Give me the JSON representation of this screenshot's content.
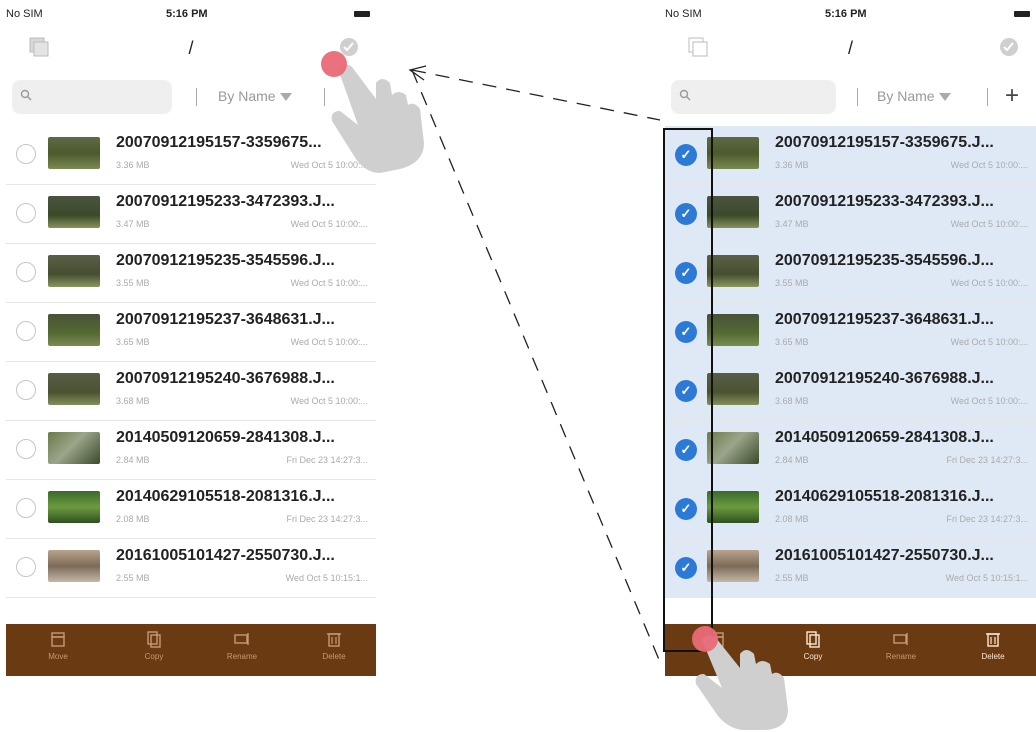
{
  "left_screen": {
    "status": {
      "carrier": "No SIM",
      "time": "5:16 PM"
    },
    "nav_title": "/",
    "search_placeholder": "",
    "sort_label": "By Name",
    "toolbar": [
      {
        "label": "Move",
        "icon": "move-icon"
      },
      {
        "label": "Copy",
        "icon": "copy-icon"
      },
      {
        "label": "Rename",
        "icon": "rename-icon"
      },
      {
        "label": "Delete",
        "icon": "trash-icon"
      }
    ],
    "files": [
      {
        "name": "20070912195157-3359675...",
        "size": "3.36 MB",
        "date": "Wed Oct 5 10:00:..."
      },
      {
        "name": "20070912195233-3472393.J...",
        "size": "3.47 MB",
        "date": "Wed Oct 5 10:00:..."
      },
      {
        "name": "20070912195235-3545596.J...",
        "size": "3.55 MB",
        "date": "Wed Oct 5 10:00:..."
      },
      {
        "name": "20070912195237-3648631.J...",
        "size": "3.65 MB",
        "date": "Wed Oct 5 10:00:..."
      },
      {
        "name": "20070912195240-3676988.J...",
        "size": "3.68 MB",
        "date": "Wed Oct 5 10:00:..."
      },
      {
        "name": "20140509120659-2841308.J...",
        "size": "2.84 MB",
        "date": "Fri Dec 23 14:27:3..."
      },
      {
        "name": "20140629105518-2081316.J...",
        "size": "2.08 MB",
        "date": "Fri Dec 23 14:27:3..."
      },
      {
        "name": "20161005101427-2550730.J...",
        "size": "2.55 MB",
        "date": "Wed Oct 5 10:15:1..."
      }
    ]
  },
  "right_screen": {
    "status": {
      "carrier": "No SIM",
      "time": "5:16 PM"
    },
    "nav_title": "/",
    "sort_label": "By Name",
    "plus_label": "+",
    "toolbar": [
      {
        "label": "",
        "icon": "move-icon"
      },
      {
        "label": "Copy",
        "icon": "copy-icon"
      },
      {
        "label": "Rename",
        "icon": "rename-icon"
      },
      {
        "label": "Delete",
        "icon": "trash-icon"
      }
    ],
    "files": [
      {
        "name": "20070912195157-3359675.J...",
        "size": "3.36 MB",
        "date": "Wed Oct 5 10:00:..."
      },
      {
        "name": "20070912195233-3472393.J...",
        "size": "3.47 MB",
        "date": "Wed Oct 5 10:00:..."
      },
      {
        "name": "20070912195235-3545596.J...",
        "size": "3.55 MB",
        "date": "Wed Oct 5 10:00:..."
      },
      {
        "name": "20070912195237-3648631.J...",
        "size": "3.65 MB",
        "date": "Wed Oct 5 10:00:..."
      },
      {
        "name": "20070912195240-3676988.J...",
        "size": "3.68 MB",
        "date": "Wed Oct 5 10:00:..."
      },
      {
        "name": "20140509120659-2841308.J...",
        "size": "2.84 MB",
        "date": "Fri Dec 23 14:27:3..."
      },
      {
        "name": "20140629105518-2081316.J...",
        "size": "2.08 MB",
        "date": "Fri Dec 23 14:27:3..."
      },
      {
        "name": "20161005101427-2550730.J...",
        "size": "2.55 MB",
        "date": "Wed Oct 5 10:15:1..."
      }
    ]
  },
  "colors": {
    "toolbar_bg": "#6a3a12",
    "check_blue": "#2d7ad6",
    "tap_marker": "#e96a78"
  }
}
